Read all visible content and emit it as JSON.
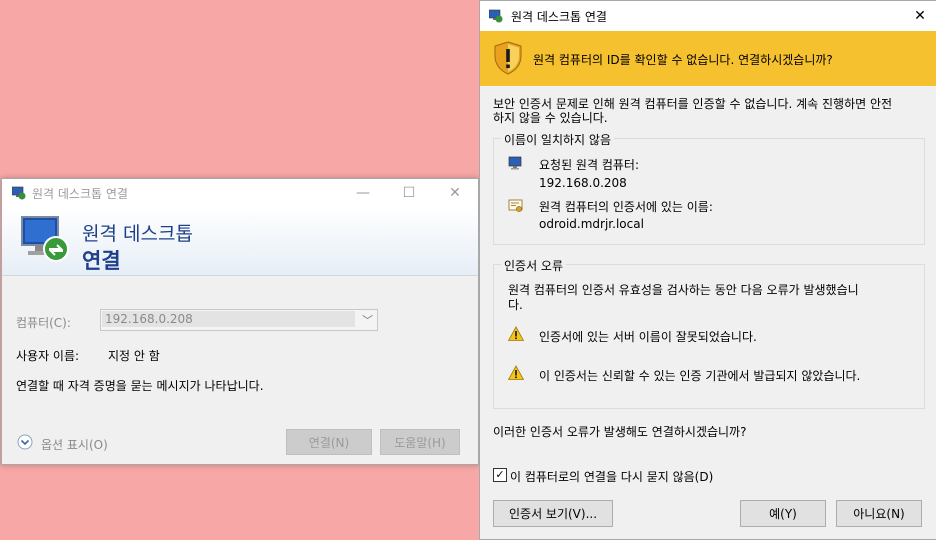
{
  "rdc": {
    "title": "원격 데스크톱 연결",
    "banner_line1": "원격 데스크톱",
    "banner_line2": "연결",
    "computer_label": "컴퓨터(C):",
    "computer_value": "192.168.0.208",
    "username_label": "사용자 이름:",
    "username_value": "지정 안 함",
    "credential_note": "연결할 때 자격 증명을 묻는 메시지가 나타납니다.",
    "options_label": "옵션 표시(O)",
    "connect_button": "연결(N)",
    "help_button": "도움말(H)",
    "minimize": "—",
    "maximize": "☐",
    "close": "✕"
  },
  "cert": {
    "title": "원격 데스크톱 연결",
    "close": "✕",
    "warning": "원격 컴퓨터의 ID를 확인할 수 없습니다. 연결하시겠습니까?",
    "intro_line1": "보안 인증서 문제로 인해 원격 컴퓨터를 인증할 수 없습니다. 계속 진행하면 안전",
    "intro_line2": "하지 않을 수 있습니다.",
    "name_mismatch": {
      "title": "이름이 일치하지 않음",
      "requested_label": "요청된 원격 컴퓨터:",
      "requested_value": "192.168.0.208",
      "cert_name_label": "원격 컴퓨터의 인증서에 있는 이름:",
      "cert_name_value": "odroid.mdrjr.local"
    },
    "cert_errors": {
      "title": "인증서 오류",
      "desc_line1": "원격 컴퓨터의 인증서 유효성을 검사하는 동안 다음 오류가 발생했습니",
      "desc_line2": "다.",
      "error1": "인증서에 있는 서버 이름이 잘못되었습니다.",
      "error2": "이 인증서는 신뢰할 수 있는 인증 기관에서 발급되지 않았습니다."
    },
    "question": "이러한 인증서 오류가 발생해도 연결하시겠습니까?",
    "dont_ask": "이 컴퓨터로의 연결을 다시 묻지 않음(D)",
    "dont_ask_checked": true,
    "check_mark": "✓",
    "view_cert_button": "인증서 보기(V)...",
    "yes_button": "예(Y)",
    "no_button": "아니요(N)"
  },
  "colors": {
    "background": "#f7a8a6",
    "warning_bar": "#f5c12e",
    "banner_text": "#1e3f8a"
  }
}
